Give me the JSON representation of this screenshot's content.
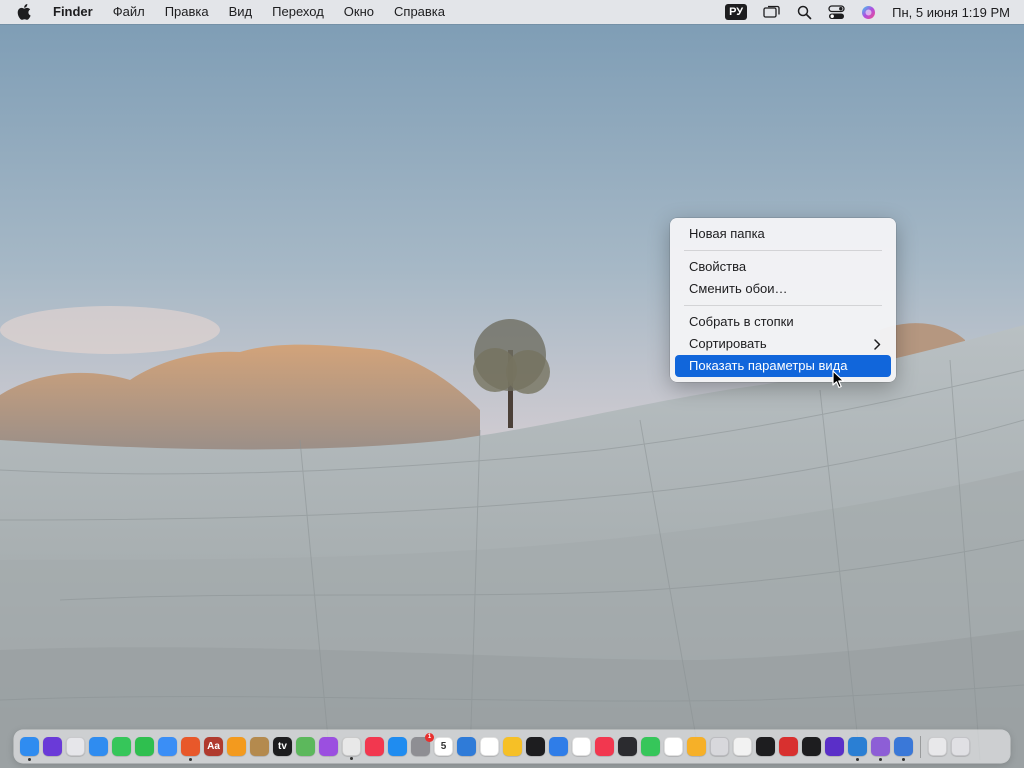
{
  "menubar": {
    "app_name": "Finder",
    "menus": [
      "Файл",
      "Правка",
      "Вид",
      "Переход",
      "Окно",
      "Справка"
    ],
    "keyboard_layout": "РУ",
    "status_icons": [
      "screen-mirroring-icon",
      "search-icon",
      "control-center-icon",
      "siri-icon"
    ],
    "datetime": "Пн, 5 июня  1:19 PM"
  },
  "context_menu": {
    "items": [
      {
        "label": "Новая папка"
      },
      {
        "label": "Свойства"
      },
      {
        "label": "Сменить обои…"
      },
      {
        "label": "Собрать в стопки"
      },
      {
        "label": "Сортировать",
        "has_submenu": true
      },
      {
        "label": "Показать параметры вида",
        "selected": true
      }
    ],
    "selection_color": "#1166db"
  },
  "dock": {
    "apps": [
      {
        "name": "finder",
        "color": "#2f8cf0",
        "running": true
      },
      {
        "name": "siri",
        "color": "#6a3ad8"
      },
      {
        "name": "launchpad",
        "color": "#e6e6ea"
      },
      {
        "name": "safari",
        "color": "#2f8cf0"
      },
      {
        "name": "messages",
        "color": "#36c65a"
      },
      {
        "name": "facetime",
        "color": "#2fbf4f"
      },
      {
        "name": "mail",
        "color": "#3a8ef6"
      },
      {
        "name": "firefox",
        "color": "#e8582a",
        "running": true
      },
      {
        "name": "dictionary",
        "color": "#b03a2e",
        "glyph": "Aa"
      },
      {
        "name": "books",
        "color": "#f39a1e"
      },
      {
        "name": "archive",
        "color": "#b48a4e"
      },
      {
        "name": "apple-tv",
        "color": "#1d1d1f",
        "glyph": "tv"
      },
      {
        "name": "maps",
        "color": "#5cb85c"
      },
      {
        "name": "podcasts",
        "color": "#9b4fe0"
      },
      {
        "name": "chrome",
        "color": "#e8e8e8",
        "running": true
      },
      {
        "name": "music",
        "color": "#f2374f"
      },
      {
        "name": "app-store",
        "color": "#1f8cf0"
      },
      {
        "name": "system-settings",
        "color": "#8e8e93",
        "badge": "1"
      },
      {
        "name": "calendar",
        "color": "#ffffff",
        "glyph": "5"
      },
      {
        "name": "weather",
        "color": "#2f7bd8"
      },
      {
        "name": "freeform",
        "color": "#ffffff"
      },
      {
        "name": "photos",
        "color": "#f6c026"
      },
      {
        "name": "stocks",
        "color": "#1d1d1f"
      },
      {
        "name": "keynote",
        "color": "#2f7de8"
      },
      {
        "name": "reminders",
        "color": "#ffffff"
      },
      {
        "name": "news",
        "color": "#f2374f"
      },
      {
        "name": "voice-memos",
        "color": "#2b2b2f"
      },
      {
        "name": "find-my",
        "color": "#36c65a"
      },
      {
        "name": "clock",
        "color": "#ffffff"
      },
      {
        "name": "home",
        "color": "#f6b028"
      },
      {
        "name": "calculator",
        "color": "#d8d8dc"
      },
      {
        "name": "textedit",
        "color": "#f2f2f2"
      },
      {
        "name": "terminal",
        "color": "#1d1d1f"
      },
      {
        "name": "photo-booth",
        "color": "#d8302f"
      },
      {
        "name": "script-editor",
        "color": "#1d1d1f"
      },
      {
        "name": "proxy-app",
        "color": "#5a2fc8"
      },
      {
        "name": "vs-code",
        "color": "#2a7fd4",
        "running": true
      },
      {
        "name": "visual-studio",
        "color": "#8d5ed6",
        "running": true
      },
      {
        "name": "xcode",
        "color": "#3a78d8",
        "running": true
      }
    ],
    "trailing": [
      {
        "name": "downloads-stack",
        "color": "#e8e8ea"
      },
      {
        "name": "trash",
        "color": "#e0e0e4"
      }
    ]
  }
}
